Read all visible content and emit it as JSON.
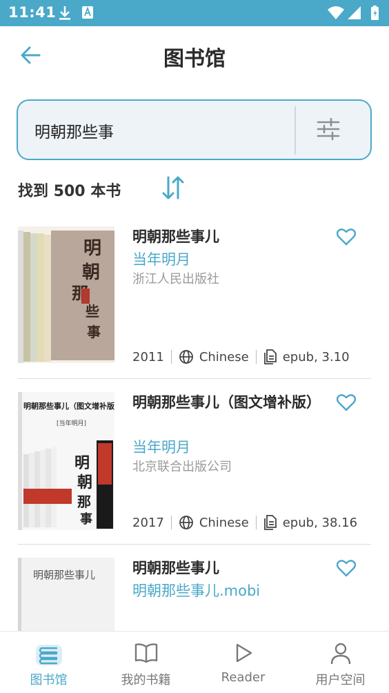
{
  "status_bar": {
    "time": "11:41"
  },
  "header": {
    "title": "图书馆"
  },
  "search": {
    "value": "明朝那些事"
  },
  "results": {
    "count_text": "找到 500 本书"
  },
  "books": [
    {
      "title": "明朝那些事儿",
      "author": "当年明月",
      "publisher": "浙江人民出版社",
      "year": "2011",
      "language": "Chinese",
      "format": "epub, 3.10",
      "cover_text": "明朝那些事儿"
    },
    {
      "title": "明朝那些事儿（图文增补版）",
      "author": "当年明月",
      "publisher": "北京联合出版公司",
      "year": "2017",
      "language": "Chinese",
      "format": "epub, 38.16",
      "cover_text": "明朝那些事儿（图文增补版）"
    },
    {
      "title": "明朝那些事儿",
      "author": "明朝那些事儿.mobi",
      "cover_text": "明朝那些事儿"
    }
  ],
  "nav": [
    {
      "label": "图书馆",
      "icon": "library-icon",
      "active": true
    },
    {
      "label": "我的书籍",
      "icon": "book-open-icon",
      "active": false
    },
    {
      "label": "Reader",
      "icon": "play-icon",
      "active": false
    },
    {
      "label": "用户空间",
      "icon": "user-icon",
      "active": false
    }
  ],
  "colors": {
    "accent": "#4aa8c9",
    "status_bar": "#4aa8c9",
    "search_bg": "#eef3f8"
  }
}
